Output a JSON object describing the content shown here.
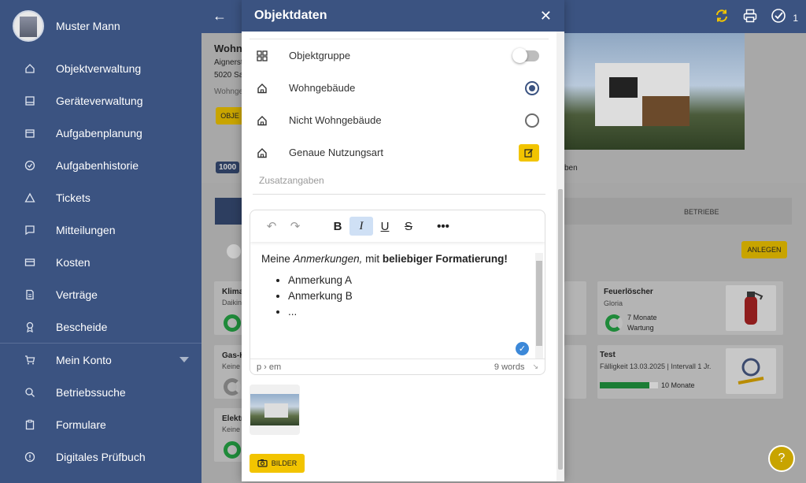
{
  "profile": {
    "name": "Muster Mann"
  },
  "sidebar": {
    "items": [
      {
        "label": "Objektverwaltung",
        "icon": "home-icon"
      },
      {
        "label": "Geräteverwaltung",
        "icon": "device-icon"
      },
      {
        "label": "Aufgabenplanung",
        "icon": "calendar-icon"
      },
      {
        "label": "Aufgabenhistorie",
        "icon": "check-circle-icon"
      },
      {
        "label": "Tickets",
        "icon": "warning-icon"
      },
      {
        "label": "Mitteilungen",
        "icon": "message-icon"
      },
      {
        "label": "Kosten",
        "icon": "card-icon"
      },
      {
        "label": "Verträge",
        "icon": "document-icon"
      },
      {
        "label": "Bescheide",
        "icon": "award-icon"
      }
    ],
    "items2": [
      {
        "label": "Mein Konto",
        "icon": "cart-icon"
      },
      {
        "label": "Betriebssuche",
        "icon": "search-icon"
      },
      {
        "label": "Formulare",
        "icon": "clipboard-icon"
      },
      {
        "label": "Digitales Prüfbuch",
        "icon": "info-icon"
      }
    ]
  },
  "topbar": {
    "tasks_count": "1"
  },
  "background": {
    "object_title": "Wohn",
    "address1": "Aignerst",
    "address2": "5020 Sa",
    "type": "Wohnge",
    "obj_btn": "OBJE",
    "code": "1000",
    "tab_betriebe": "BETRIEBE",
    "anlegen": "ANLEGEN",
    "side_text": "ben",
    "card1": {
      "title": "Klima",
      "sub": "Daikin"
    },
    "card2": {
      "title": "Gas-H",
      "sub": "Keine"
    },
    "card3": {
      "title": "Elektr",
      "sub": "Keine"
    },
    "feuer": {
      "title": "Feuerlöscher",
      "brand": "Gloria",
      "months": "7 Monate",
      "label": "Wartung"
    },
    "test": {
      "title": "Test",
      "due": "Fälligkeit 13.03.2025 | Intervall 1 Jr.",
      "months": "10 Monate",
      "progress": 0.85
    }
  },
  "modal": {
    "title": "Objektdaten",
    "rows": [
      {
        "label": "Objektgruppe",
        "control": "toggle",
        "value": false
      },
      {
        "label": "Wohngebäude",
        "control": "radio",
        "value": true
      },
      {
        "label": "Nicht Wohngebäude",
        "control": "radio",
        "value": false
      },
      {
        "label": "Genaue Nutzungsart",
        "control": "edit"
      }
    ],
    "zusatz_placeholder": "Zusatzangaben",
    "editor": {
      "intro_plain": "Meine ",
      "intro_italic": "Anmerkungen,",
      "intro_mid": " mit ",
      "intro_bold": "beliebiger Formatierung!",
      "bullets": [
        "Anmerkung A",
        "Anmerkung B",
        "..."
      ],
      "path": "p › em",
      "wordcount": "9 words"
    },
    "bilder_label": "BILDER"
  },
  "colors": {
    "primary": "#3b5381",
    "accent": "#f2c400",
    "success": "#1b7d35"
  }
}
